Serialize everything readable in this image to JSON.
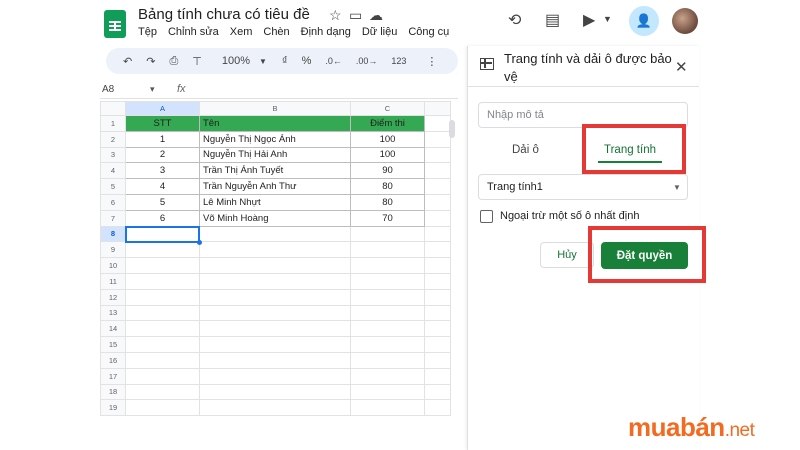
{
  "header": {
    "doc_title": "Bảng tính chưa có tiêu đề",
    "menu": [
      "Tệp",
      "Chỉnh sửa",
      "Xem",
      "Chèn",
      "Định dạng",
      "Dữ liệu",
      "Công cụ"
    ]
  },
  "toolbar": {
    "undo": "↶",
    "redo": "↷",
    "print": "⎙",
    "paint": "⊤",
    "zoom": "100%",
    "currency": "₫",
    "percent": "%",
    "dec_less": ".0←",
    "dec_more": ".00→",
    "number_format": "123"
  },
  "formula_bar": {
    "cell_ref": "A8",
    "fx": "fx"
  },
  "sheet": {
    "columns": [
      "A",
      "B",
      "C"
    ],
    "header_row": [
      "STT",
      "Tên",
      "Điểm thi"
    ],
    "rows": [
      [
        "1",
        "Nguyễn Thị Ngọc Ánh",
        "100"
      ],
      [
        "2",
        "Nguyễn Thị Hải Anh",
        "100"
      ],
      [
        "3",
        "Trần Thị Ánh Tuyết",
        "90"
      ],
      [
        "4",
        "Trần Nguyễn Anh Thư",
        "80"
      ],
      [
        "5",
        "Lê Minh Nhựt",
        "80"
      ],
      [
        "6",
        "Võ Minh Hoàng",
        "70"
      ]
    ],
    "row_numbers": [
      "1",
      "2",
      "3",
      "4",
      "5",
      "6",
      "7",
      "8",
      "9",
      "10",
      "11",
      "12",
      "13",
      "14",
      "15",
      "16",
      "17",
      "18",
      "19"
    ],
    "selected_row": "8",
    "selected_col": "A",
    "header_color": "#34a853"
  },
  "panel": {
    "title": "Trang tính và dải ô được bảo vệ",
    "description_placeholder": "Nhập mô tả",
    "tabs": [
      "Dải ô",
      "Trang tính"
    ],
    "active_tab": "Trang tính",
    "sheet_selected": "Trang tính1",
    "except_label": "Ngoại trừ một số ô nhất định",
    "cancel_label": "Hủy",
    "set_label": "Đặt quyền",
    "accent_color": "#188038",
    "highlight_color": "#e53935"
  },
  "watermark": {
    "main": "muabán",
    "suffix": ".net"
  }
}
